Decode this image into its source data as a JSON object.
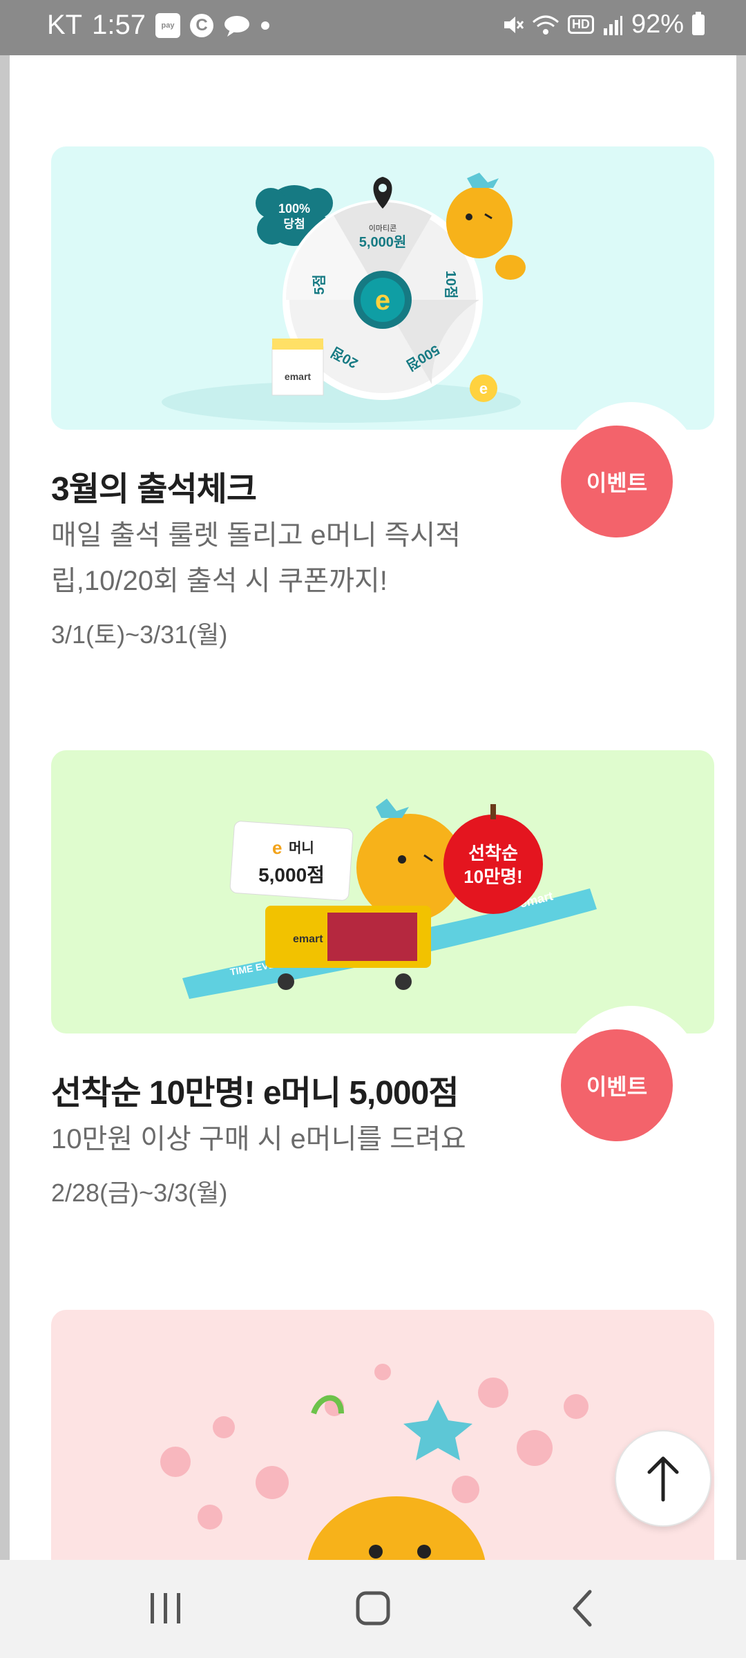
{
  "status_bar": {
    "carrier": "KT",
    "time": "1:57",
    "pay_label": "pay",
    "c_label": "C",
    "hd_label": "HD",
    "battery": "92%"
  },
  "events": [
    {
      "title": "3월의 출석체크",
      "desc": "매일 출석 룰렛 돌리고 e머니 즉시적립,10/20회 출석 시 쿠폰까지!",
      "date": "3/1(토)~3/31(월)",
      "badge": "이벤트",
      "banner_color": "#dcfaf8",
      "banner_text": {
        "guarantee": "100% 당첨",
        "slot_top_label": "이마티콘",
        "slot_top_value": "5,000원",
        "slot_right": "10점",
        "slot_br": "500점",
        "slot_bl": "20점",
        "slot_left": "5점",
        "brand": "emart"
      }
    },
    {
      "title": "선착순 10만명! e머니 5,000점",
      "desc": "10만원 이상 구매 시 e머니를 드려요",
      "date": "2/28(금)~3/3(월)",
      "badge": "이벤트",
      "banner_color": "#dffcce",
      "banner_text": {
        "ticket_e": "e",
        "ticket_label": "머니",
        "ticket_value": "5,000점",
        "apple_line1": "선착순",
        "apple_line2": "10만명!",
        "ribbon": "TIME EVENT",
        "brand": "emart"
      }
    },
    {
      "banner_color": "#fde3e3"
    }
  ],
  "colors": {
    "badge": "#f3636b",
    "title": "#1f1f1f",
    "desc": "#6b6b6b"
  }
}
